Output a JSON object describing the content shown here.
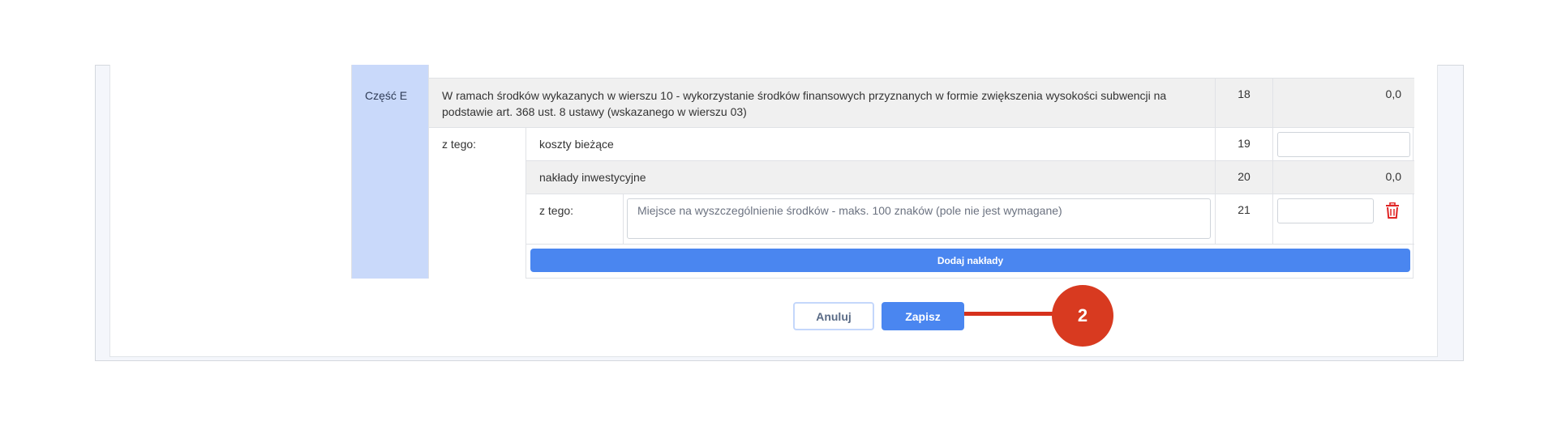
{
  "section": {
    "part_label": "Część E",
    "main_row": {
      "description": "W ramach środków wykazanych w wierszu 10 - wykorzystanie środków finansowych przyznanych w formie zwiększenia wysokości subwencji na podstawie art. 368 ust. 8 ustawy (wskazanego w wierszu 03)",
      "row_number": "18",
      "value": "0,0"
    },
    "of_which_label": "z tego:",
    "current_costs": {
      "label": "koszty bieżące",
      "row_number": "19",
      "value": ""
    },
    "investment": {
      "label": "nakłady inwestycyjne",
      "row_number": "20",
      "value": "0,0"
    },
    "investment_detail": {
      "of_which_label": "z tego:",
      "textarea_placeholder": "Miejsce na wyszczególnienie środków - maks. 100 znaków (pole nie jest wymagane)",
      "row_number": "21",
      "value": "",
      "delete_icon": "trash-icon"
    },
    "add_button_label": "Dodaj nakłady"
  },
  "actions": {
    "cancel_label": "Anuluj",
    "save_label": "Zapisz"
  },
  "annotation": {
    "badge_number": "2"
  },
  "colors": {
    "primary": "#4a86f0",
    "part_bg": "#c9d9fa",
    "gray_row": "#f0f0f0",
    "danger": "#e02424",
    "annotation": "#d83a20"
  }
}
